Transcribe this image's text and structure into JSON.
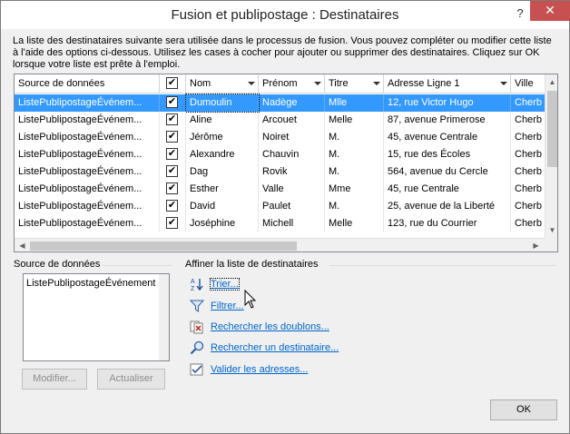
{
  "window": {
    "title": "Fusion et publipostage : Destinataires",
    "help": "?",
    "close": "✕"
  },
  "intro": "La liste des destinataires suivante sera utilisée dans le processus de fusion. Vous pouvez compléter ou modifier cette liste à l'aide des options ci-dessous. Utilisez les cases à cocher pour ajouter ou supprimer des destinataires. Cliquez sur OK lorsque votre liste est prête à l'emploi.",
  "table": {
    "headers": {
      "source": "Source de données",
      "nom": "Nom",
      "prenom": "Prénom",
      "titre": "Titre",
      "adresse": "Adresse Ligne 1",
      "ville": "Ville"
    },
    "rows": [
      {
        "source": "ListePublipostageÉvénem...",
        "checked": true,
        "nom": "Dumoulin",
        "prenom": "Nadège",
        "titre": "Mlle",
        "adresse": "12, rue Victor Hugo",
        "ville": "Cherb"
      },
      {
        "source": "ListePublipostageÉvénem...",
        "checked": true,
        "nom": "Aline",
        "prenom": "Arcouet",
        "titre": "Melle",
        "adresse": "87, avenue Primerose",
        "ville": "Cherb"
      },
      {
        "source": "ListePublipostageÉvénem...",
        "checked": true,
        "nom": "Jérôme",
        "prenom": "Noiret",
        "titre": "M.",
        "adresse": "45, avenue Centrale",
        "ville": "Cherb"
      },
      {
        "source": "ListePublipostageÉvénem...",
        "checked": true,
        "nom": "Alexandre",
        "prenom": "Chauvin",
        "titre": "M.",
        "adresse": "15, rue des Écoles",
        "ville": "Cherb"
      },
      {
        "source": "ListePublipostageÉvénem...",
        "checked": true,
        "nom": "Dag",
        "prenom": "Rovik",
        "titre": "M.",
        "adresse": "564, avenue du Cercle",
        "ville": "Cherb"
      },
      {
        "source": "ListePublipostageÉvénem...",
        "checked": true,
        "nom": "Esther",
        "prenom": "Valle",
        "titre": "Mme",
        "adresse": "45, rue Centrale",
        "ville": "Cherb"
      },
      {
        "source": "ListePublipostageÉvénem...",
        "checked": true,
        "nom": "David",
        "prenom": "Paulet",
        "titre": "M.",
        "adresse": "25, avenue de la Liberté",
        "ville": "Cherb"
      },
      {
        "source": "ListePublipostageÉvénem...",
        "checked": true,
        "nom": "Joséphine",
        "prenom": "Michell",
        "titre": "Melle",
        "adresse": "123, rue du Courrier",
        "ville": "Cherb"
      }
    ]
  },
  "datasource": {
    "label": "Source de données",
    "item": "ListePublipostageÉvénement",
    "modify": "Modifier...",
    "refresh": "Actualiser"
  },
  "refine": {
    "label": "Affiner la liste de destinataires",
    "links": [
      {
        "text": "Trier...",
        "icon": "sort-az-icon"
      },
      {
        "text": "Filtrer...",
        "icon": "filter-icon"
      },
      {
        "text": "Rechercher les doublons...",
        "icon": "duplicates-icon"
      },
      {
        "text": "Rechercher un destinataire...",
        "icon": "find-recipient-icon"
      },
      {
        "text": "Valider les adresses...",
        "icon": "validate-addresses-icon"
      }
    ]
  },
  "ok": "OK",
  "colors": {
    "selection": "#3399ff",
    "link": "#0066cc",
    "close": "#c75050"
  }
}
